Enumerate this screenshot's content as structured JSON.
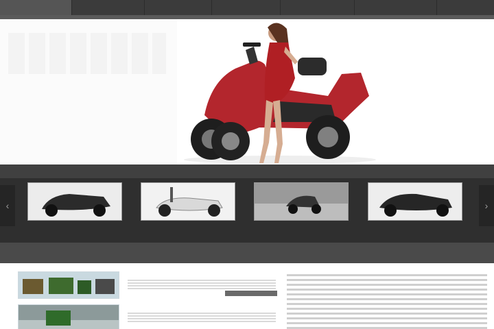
{
  "nav": {
    "logo": "",
    "items": [
      "",
      "",
      "",
      "",
      "",
      ""
    ]
  },
  "hero": {
    "pager": ""
  },
  "gallery": {
    "heading": "",
    "prev": "‹",
    "next": "›",
    "items": [
      {
        "caption": ""
      },
      {
        "caption": ""
      },
      {
        "caption": ""
      },
      {
        "caption": ""
      }
    ]
  },
  "sections": {
    "news_title": "",
    "about_title": ""
  },
  "news": [
    {
      "date": ""
    },
    {
      "date": ""
    }
  ],
  "colors": {
    "nav_bg": "#3b3b3b",
    "accent_date": "#e59c3b",
    "scooter_red": "#b3262d"
  }
}
